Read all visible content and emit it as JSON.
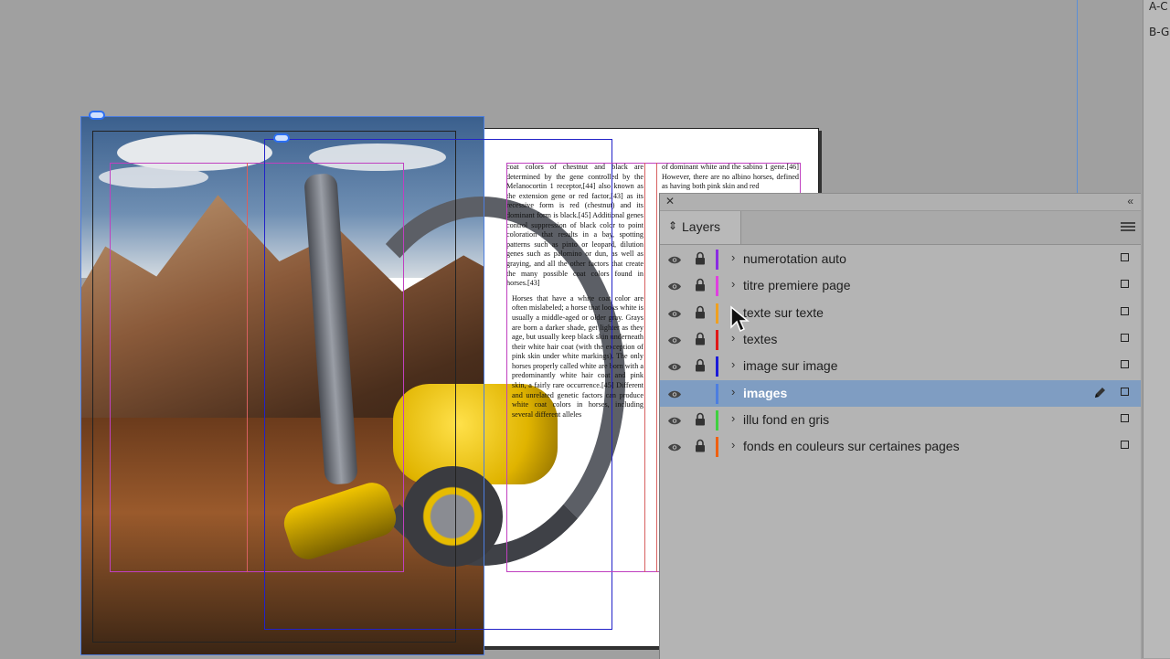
{
  "right_strip": {
    "labels": [
      "A-C",
      "B-G"
    ]
  },
  "columns": {
    "left": [
      "coat colors of chestnut and black are determined by the gene controlled by the Melanocortin 1 receptor,[44] also known as the extension gene or red factor,[43] as its recessive form is red (chestnut) and its dominant form is black.[45] Additional genes control suppression of black color to point coloration that results in a bay, spotting patterns such as pinto or leopard, dilution genes such as palomino or dun, as well as graying, and all the other factors that create the many possible coat colors found in horses.[43]",
      "Horses that have a white coat color are often mislabeled; a horse that looks white is usually a middle-aged or older gray. Grays are born a darker shade, get lighter as they age, but usually keep black skin underneath their white hair coat (with the exception of pink skin under white markings). The only horses properly called white are born with a predominantly white hair coat and pink skin, a fairly rare occurrence.[45] Different and unrelated genetic factors can produce white coat colors in horses, including several different alleles"
    ],
    "right": [
      "of dominant white and the sabino 1 gene.[46] However, there are no albino horses, defined as having both pink skin and red"
    ]
  },
  "layers_panel": {
    "title": "Layers",
    "layers": [
      {
        "name": "numerotation auto",
        "color": "#8a2be2",
        "locked": true,
        "visible": true,
        "selected": false
      },
      {
        "name": "titre premiere page",
        "color": "#e040e0",
        "locked": true,
        "visible": true,
        "selected": false
      },
      {
        "name": "texte sur texte",
        "color": "#f0a020",
        "locked": true,
        "visible": true,
        "selected": false
      },
      {
        "name": "textes",
        "color": "#e01818",
        "locked": true,
        "visible": true,
        "selected": false
      },
      {
        "name": "image sur image",
        "color": "#1a1ad8",
        "locked": true,
        "visible": true,
        "selected": false
      },
      {
        "name": "images",
        "color": "#4d7ee0",
        "locked": false,
        "visible": true,
        "selected": true
      },
      {
        "name": "illu fond en gris",
        "color": "#40d040",
        "locked": true,
        "visible": true,
        "selected": false
      },
      {
        "name": "fonds en couleurs sur certaines pages",
        "color": "#f06010",
        "locked": true,
        "visible": true,
        "selected": false
      }
    ]
  }
}
